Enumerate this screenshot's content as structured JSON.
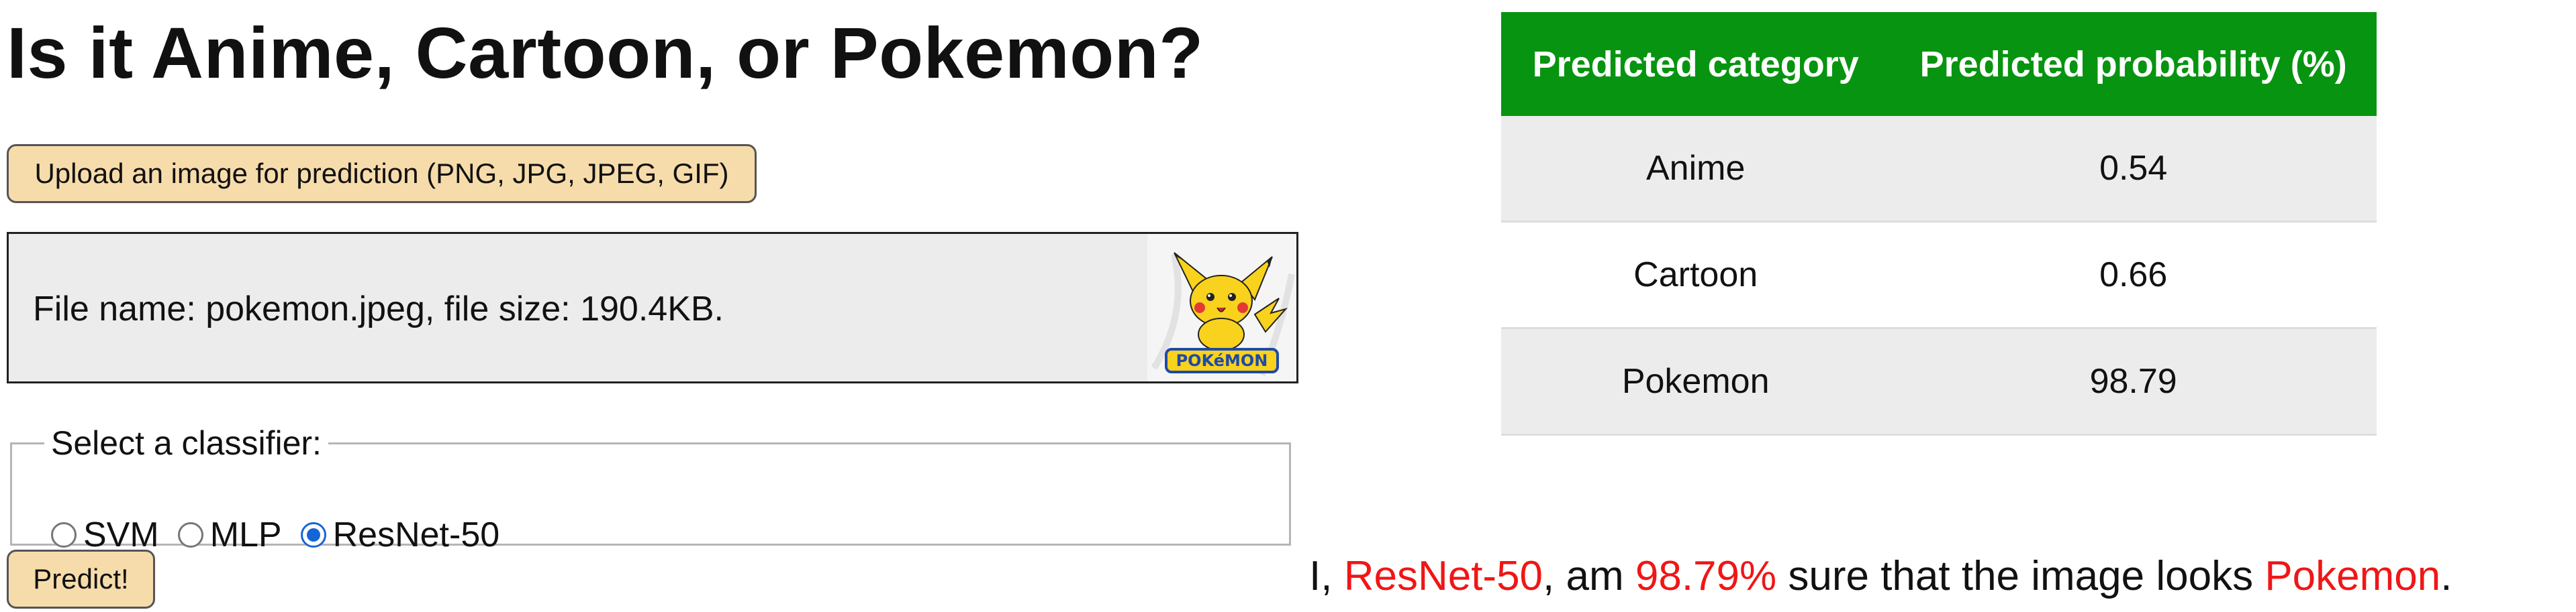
{
  "page": {
    "title": "Is it Anime, Cartoon, or Pokemon?"
  },
  "upload": {
    "button_label": "Upload an image for prediction (PNG, JPG, JPEG, GIF)"
  },
  "file": {
    "info": "File name: pokemon.jpeg, file size: 190.4KB.",
    "thumbnail_icon": "pikachu-thumbnail"
  },
  "classifier": {
    "legend": "Select a classifier:",
    "options": [
      {
        "label": "SVM",
        "checked": false
      },
      {
        "label": "MLP",
        "checked": false
      },
      {
        "label": "ResNet-50",
        "checked": true
      }
    ]
  },
  "predict": {
    "button_label": "Predict!"
  },
  "results": {
    "headers": [
      "Predicted category",
      "Predicted probability (%)"
    ],
    "rows": [
      {
        "category": "Anime",
        "probability": "0.54"
      },
      {
        "category": "Cartoon",
        "probability": "0.66"
      },
      {
        "category": "Pokemon",
        "probability": "98.79"
      }
    ]
  },
  "verdict": {
    "prefix": "I, ",
    "model": "ResNet-50",
    "middle": ", am ",
    "confidence": "98.79%",
    "middle2": " sure that the image looks ",
    "category": "Pokemon",
    "suffix": "."
  },
  "colors": {
    "header_green": "#079410",
    "highlight_red": "#f01616",
    "button_bg": "#f7dcab",
    "radio_blue": "#1565d8"
  }
}
